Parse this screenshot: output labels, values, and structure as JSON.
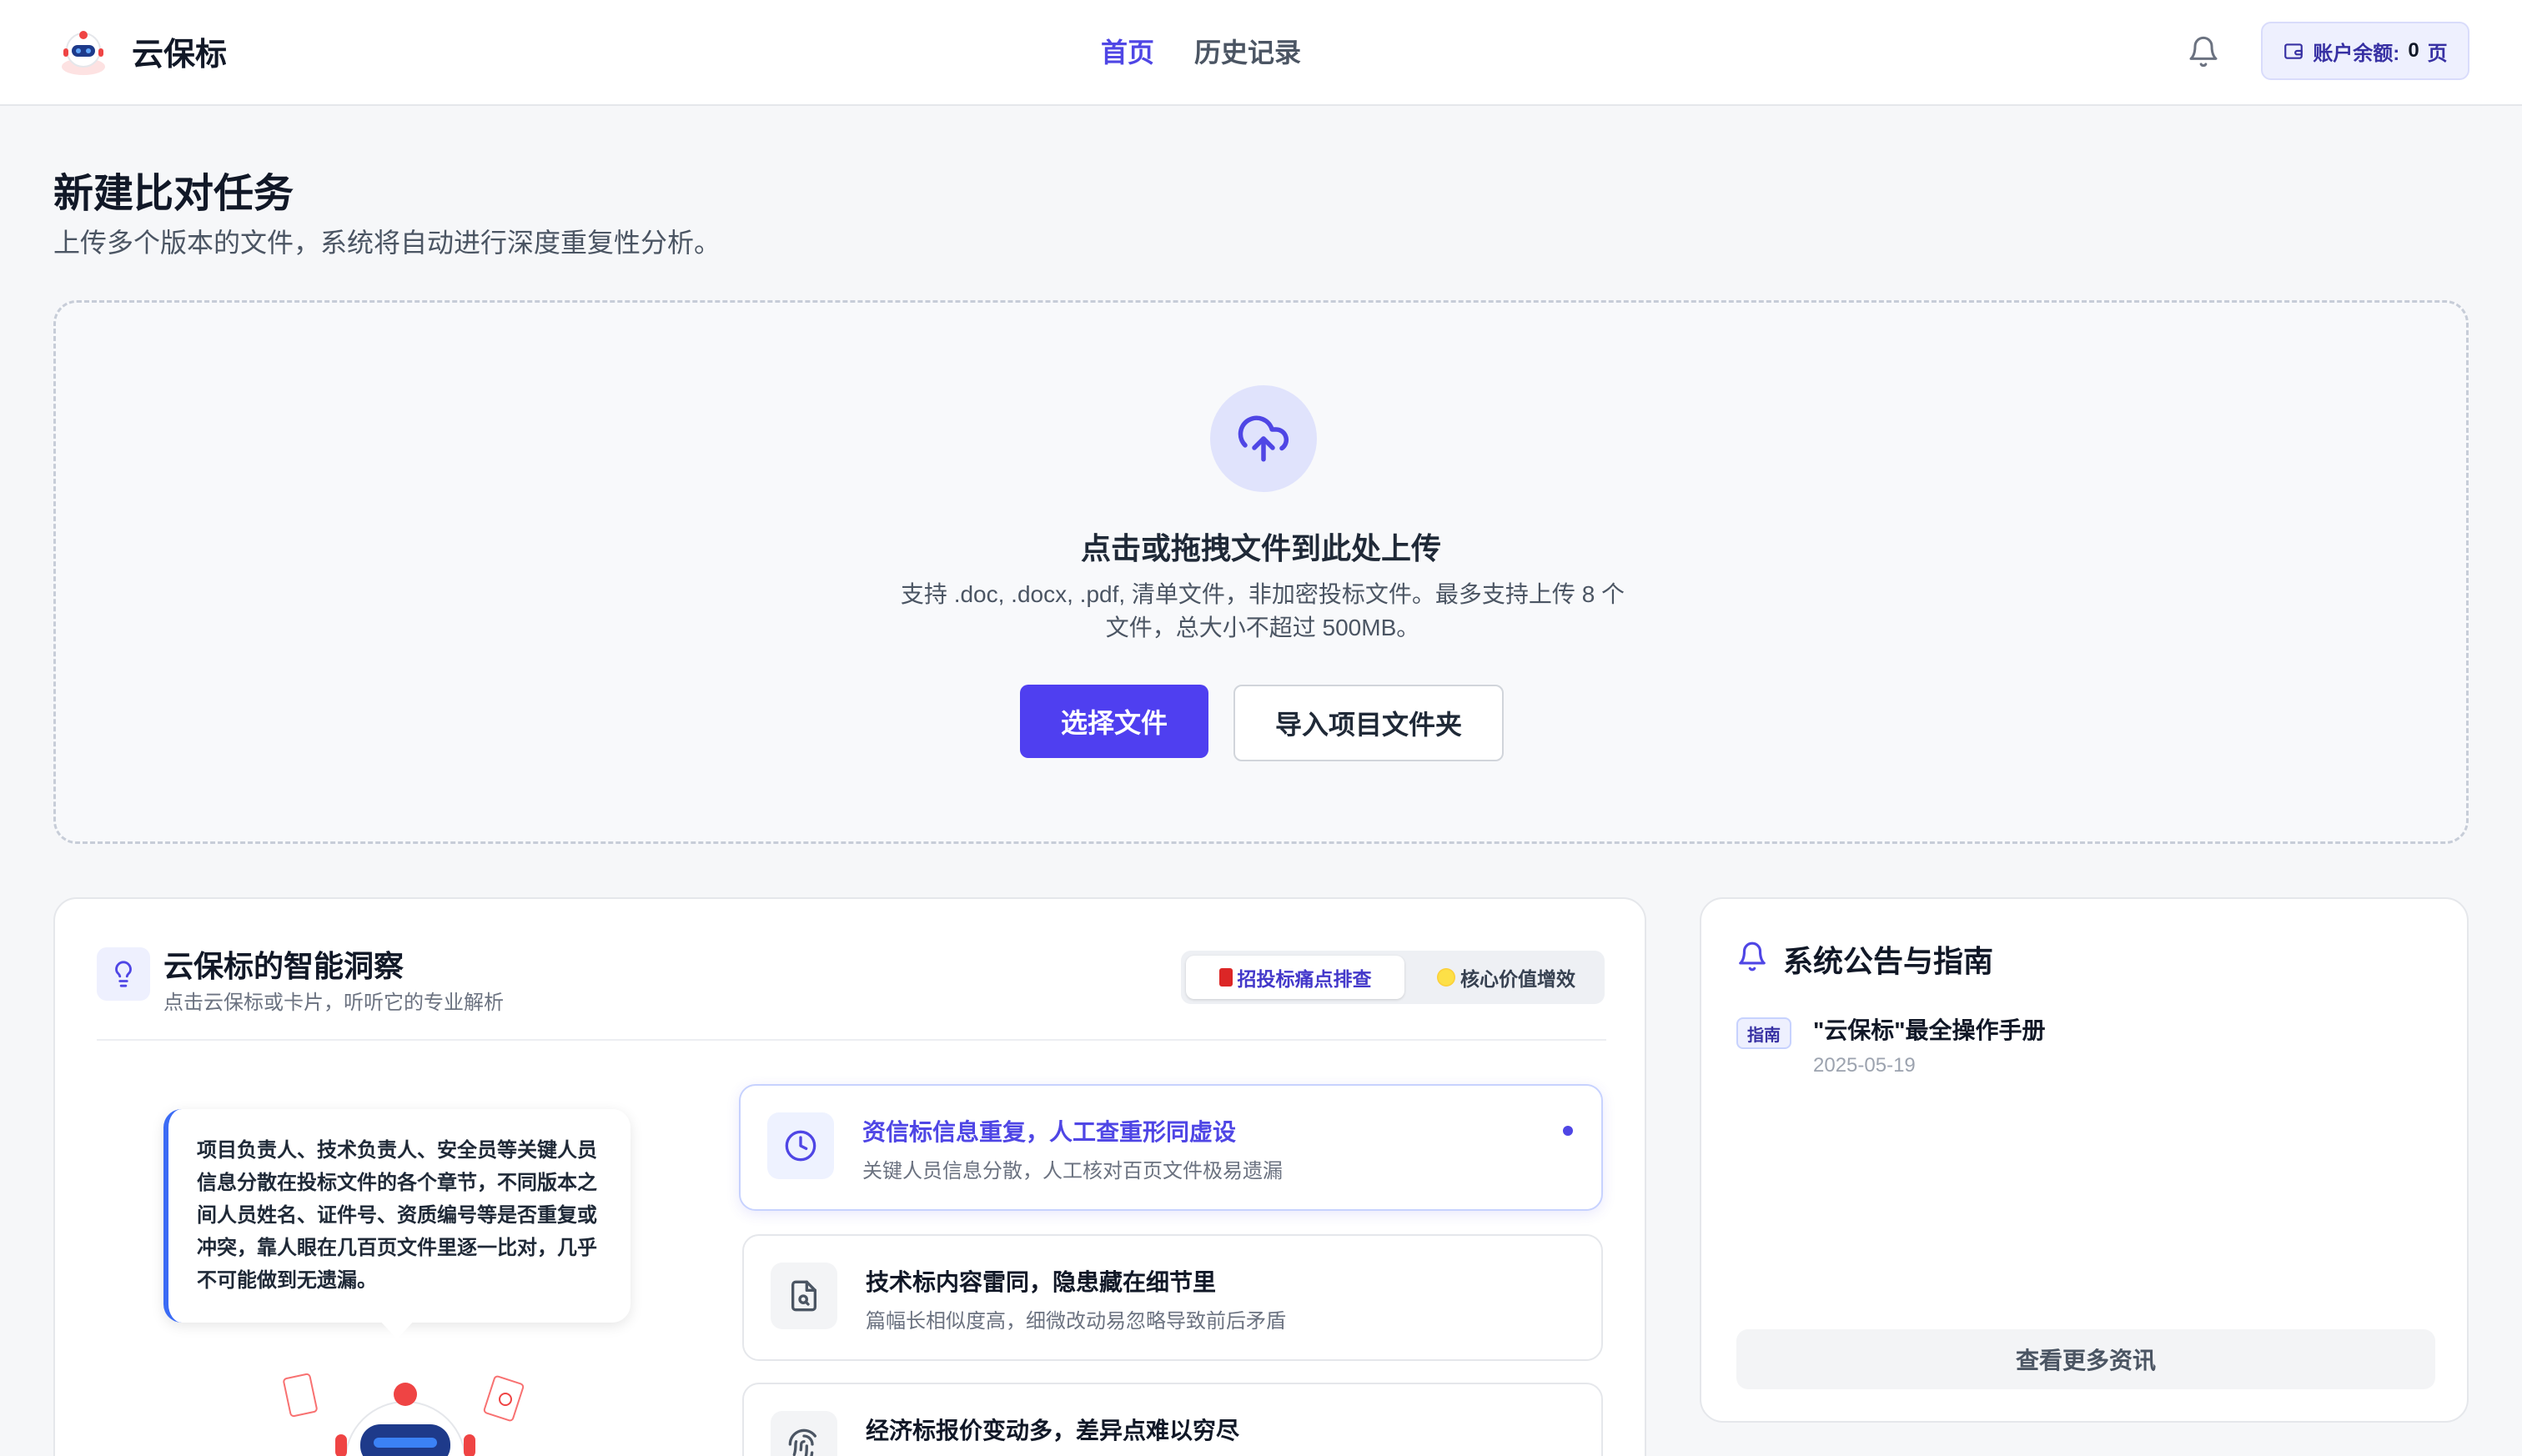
{
  "header": {
    "app_name": "云保标",
    "nav": {
      "home": "首页",
      "history": "历史记录"
    },
    "balance_label": "账户余额:",
    "balance_value": "0",
    "balance_unit": "页"
  },
  "page": {
    "title": "新建比对任务",
    "subtitle": "上传多个版本的文件，系统将自动进行深度重复性分析。"
  },
  "upload": {
    "title": "点击或拖拽文件到此处上传",
    "desc_line1": "支持 .doc, .docx, .pdf, 清单文件，非加密投标文件。最多支持上传 8 个",
    "desc_line2": "文件，总大小不超过 500MB。",
    "choose_button": "选择文件",
    "import_button": "导入项目文件夹"
  },
  "insight": {
    "title": "云保标的智能洞察",
    "subtitle": "点击云保标或卡片，听听它的专业解析",
    "tabs": [
      "招投标痛点排查",
      "核心价值增效"
    ],
    "bubble_text": "项目负责人、技术负责人、安全员等关键人员信息分散在投标文件的各个章节，不同版本之间人员姓名、证件号、资质编号等是否重复或冲突，靠人眼在几百页文件里逐一比对，几乎不可能做到无遗漏。",
    "items": [
      {
        "title": "资信标信息重复，人工查重形同虚设",
        "desc": "关键人员信息分散，人工核对百页文件极易遗漏",
        "icon": "clock-icon"
      },
      {
        "title": "技术标内容雷同，隐患藏在细节里",
        "desc": "篇幅长相似度高，细微改动易忽略导致前后矛盾",
        "icon": "file-search-icon"
      },
      {
        "title": "经济标报价变动多，差异点难以穷尽",
        "desc": "",
        "icon": "fingerprint-icon"
      }
    ]
  },
  "notice": {
    "title": "系统公告与指南",
    "items": [
      {
        "tag": "指南",
        "title": "\"云保标\"最全操作手册",
        "date": "2025-05-19"
      }
    ],
    "more_button": "查看更多资讯"
  },
  "colors": {
    "accent": "#4f46e5",
    "primary_button": "#4f3ff0",
    "bubble_border": "#3b6bf5"
  }
}
